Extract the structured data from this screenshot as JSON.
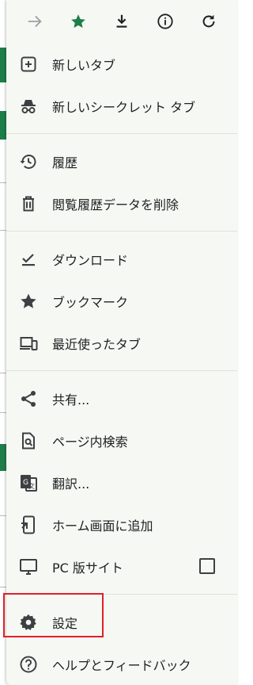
{
  "toolbar": {
    "buttons": [
      {
        "name": "back-arrow-icon"
      },
      {
        "name": "bookmark-star-icon"
      },
      {
        "name": "download-icon"
      },
      {
        "name": "info-icon"
      },
      {
        "name": "reload-icon"
      }
    ]
  },
  "menu": {
    "items": [
      {
        "label": "新しいタブ",
        "icon": "plus-box-icon"
      },
      {
        "label": "新しいシークレット タブ",
        "icon": "incognito-icon"
      },
      {
        "label": "履歴",
        "icon": "history-icon"
      },
      {
        "label": "閲覧履歴データを削除",
        "icon": "trash-icon"
      },
      {
        "label": "ダウンロード",
        "icon": "download-check-icon"
      },
      {
        "label": "ブックマーク",
        "icon": "star-icon"
      },
      {
        "label": "最近使ったタブ",
        "icon": "devices-icon"
      },
      {
        "label": "共有...",
        "icon": "share-icon"
      },
      {
        "label": "ページ内検索",
        "icon": "find-in-page-icon"
      },
      {
        "label": "翻訳...",
        "icon": "translate-icon"
      },
      {
        "label": "ホーム画面に追加",
        "icon": "add-to-home-icon"
      },
      {
        "label": "PC 版サイト",
        "icon": "desktop-icon"
      },
      {
        "label": "設定",
        "icon": "gear-icon"
      },
      {
        "label": "ヘルプとフィードバック",
        "icon": "help-icon"
      }
    ]
  },
  "colors": {
    "menu_bg": "#f6f9f3",
    "accent_green": "#1e7e4a",
    "highlight_red": "#e0202a",
    "icon": "#3c4043"
  }
}
